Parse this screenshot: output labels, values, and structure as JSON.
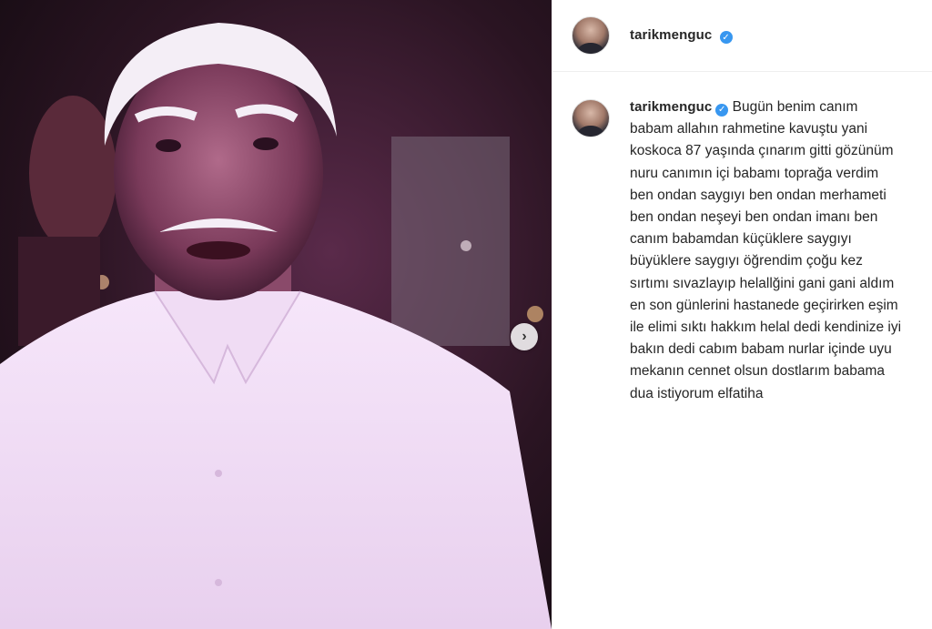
{
  "post": {
    "username": "tarikmenguc",
    "verified_badge": "✓",
    "next_icon": "›",
    "caption": "Bugün benim canım babam allahın rahmetine kavuştu yani koskoca 87 yaşında çınarım gitti gözünüm nuru canımın içi babamı toprağa verdim ben ondan saygıyı ben ondan merhameti ben ondan neşeyi ben ondan imanı ben canım babamdan küçüklere saygıyı büyüklere saygıyı öğrendim çoğu kez sırtımı sıvazlayıp helallğini gani gani aldım en son günlerini hastanede geçirirken eşim ile elimi sıktı hakkım helal dedi kendinize iyi bakın dedi cabım babam nurlar içinde uyu mekanın cennet olsun dostlarım babama dua istiyorum elfatiha"
  },
  "colors": {
    "accent": "#3897f0",
    "text": "#262626",
    "border": "#efefef"
  }
}
